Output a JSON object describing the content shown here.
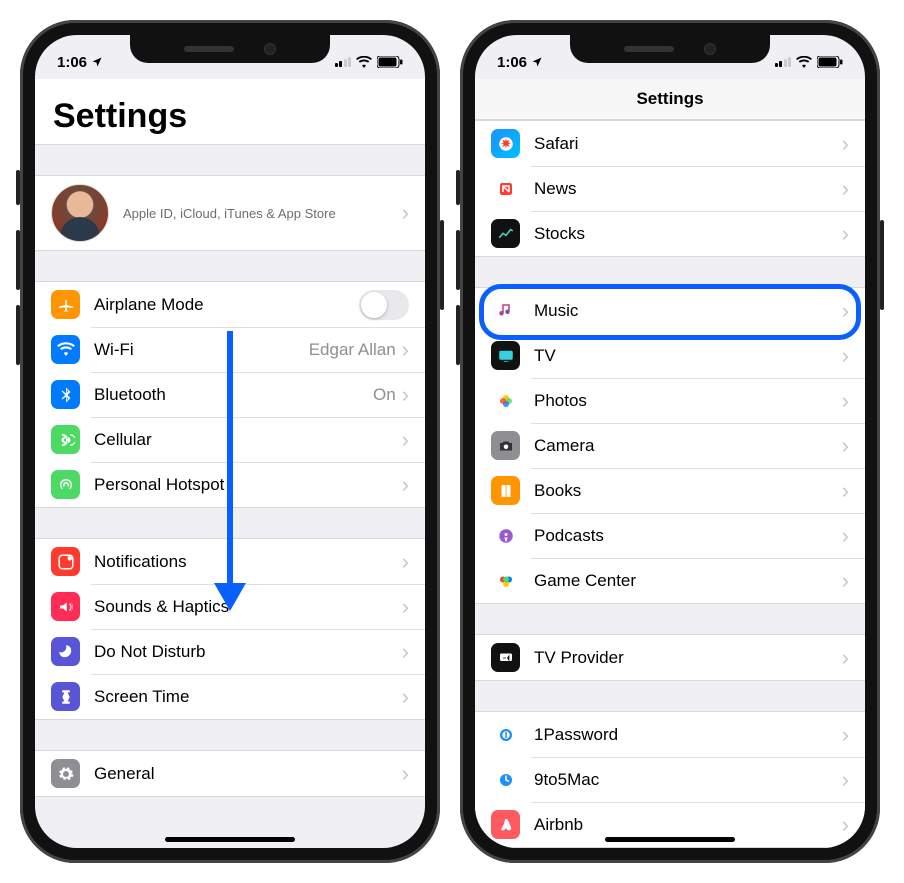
{
  "statusbar": {
    "time": "1:06"
  },
  "left": {
    "title": "Settings",
    "apple_sub": "Apple ID, iCloud, iTunes & App Store",
    "group1": [
      {
        "icon": "airplane",
        "bg": "#ff9500",
        "label": "Airplane Mode",
        "toggle": true
      },
      {
        "icon": "wifi",
        "bg": "#007aff",
        "label": "Wi-Fi",
        "value": "Edgar Allan",
        "chev": true
      },
      {
        "icon": "bluetooth",
        "bg": "#007aff",
        "label": "Bluetooth",
        "value": "On",
        "chev": true
      },
      {
        "icon": "cellular",
        "bg": "#4cd964",
        "label": "Cellular",
        "chev": true
      },
      {
        "icon": "hotspot",
        "bg": "#4cd964",
        "label": "Personal Hotspot",
        "chev": true
      }
    ],
    "group2": [
      {
        "icon": "notifications",
        "bg": "#ff3b30",
        "label": "Notifications",
        "chev": true
      },
      {
        "icon": "sounds",
        "bg": "#ff2d55",
        "label": "Sounds & Haptics",
        "chev": true
      },
      {
        "icon": "dnd",
        "bg": "#5856d6",
        "label": "Do Not Disturb",
        "chev": true
      },
      {
        "icon": "screentime",
        "bg": "#5856d6",
        "label": "Screen Time",
        "chev": true
      }
    ],
    "group3": [
      {
        "icon": "general",
        "bg": "#8e8e93",
        "label": "General",
        "chev": true
      }
    ]
  },
  "right": {
    "header": "Settings",
    "g1": [
      {
        "icon": "safari",
        "bg": "linear-gradient(135deg,#1e90ff,#00bfff)",
        "label": "Safari",
        "chev": true
      },
      {
        "icon": "news",
        "bg": "#fff",
        "label": "News",
        "chev": true
      },
      {
        "icon": "stocks",
        "bg": "#111",
        "label": "Stocks",
        "chev": true
      }
    ],
    "g2": [
      {
        "icon": "music",
        "bg": "#fff",
        "label": "Music",
        "chev": true,
        "hl": true
      },
      {
        "icon": "tv",
        "bg": "#111",
        "label": "TV",
        "chev": true
      },
      {
        "icon": "photos",
        "bg": "#fff",
        "label": "Photos",
        "chev": true
      },
      {
        "icon": "camera",
        "bg": "#8e8e93",
        "label": "Camera",
        "chev": true
      },
      {
        "icon": "books",
        "bg": "#ff9500",
        "label": "Books",
        "chev": true
      },
      {
        "icon": "podcasts",
        "bg": "#fff",
        "label": "Podcasts",
        "chev": true
      },
      {
        "icon": "gamecenter",
        "bg": "#fff",
        "label": "Game Center",
        "chev": true
      }
    ],
    "g3": [
      {
        "icon": "tvprovider",
        "bg": "#111",
        "label": "TV Provider",
        "chev": true
      }
    ],
    "g4": [
      {
        "icon": "onepass",
        "bg": "#fff",
        "label": "1Password",
        "chev": true
      },
      {
        "icon": "ninetofive",
        "bg": "#fff",
        "label": "9to5Mac",
        "chev": true
      },
      {
        "icon": "airbnb",
        "bg": "#ff5a5f",
        "label": "Airbnb",
        "chev": true
      }
    ]
  }
}
